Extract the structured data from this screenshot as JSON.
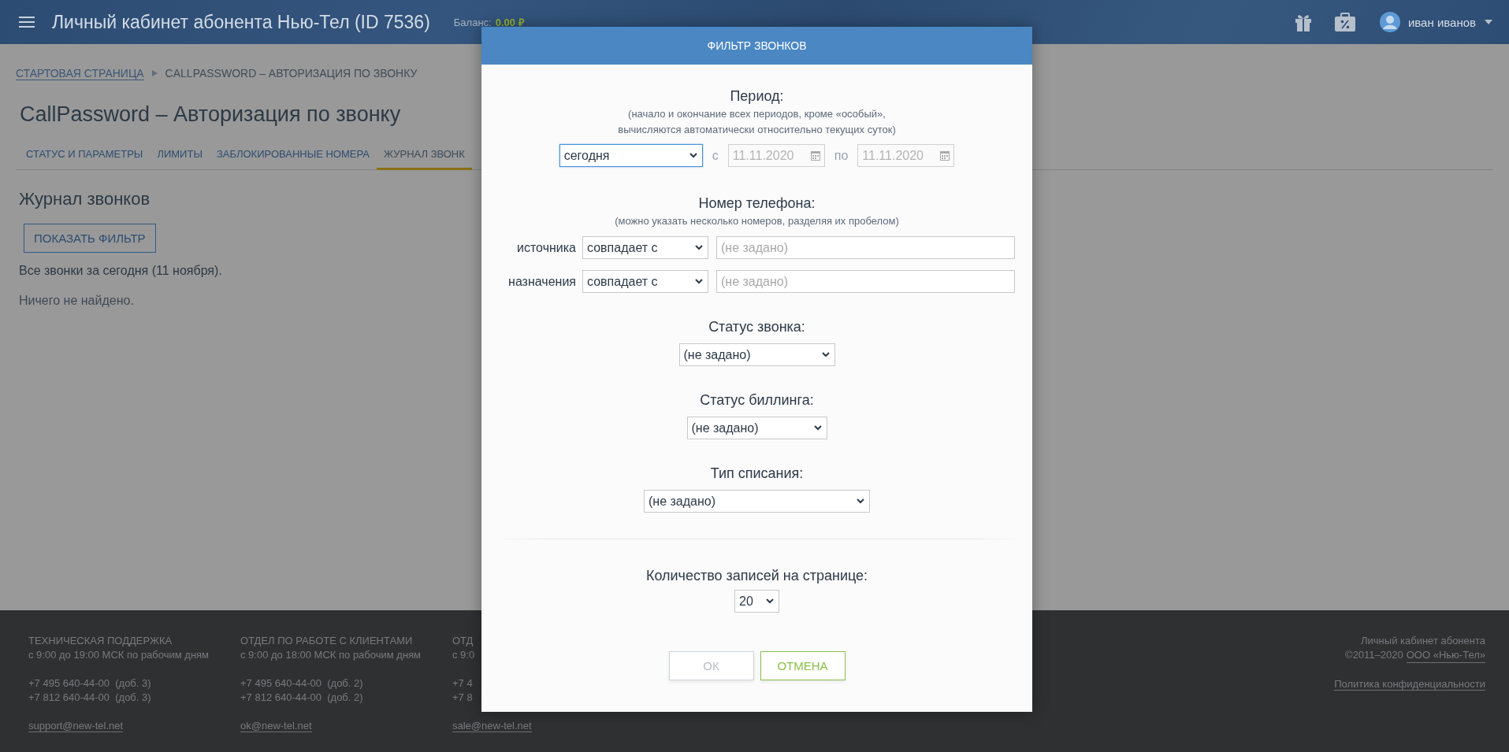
{
  "header": {
    "title": "Личный кабинет абонента Нью-Тел (ID 7536)",
    "balance_label": "Баланс:",
    "balance_value": "0.00 ₽",
    "user_name": "иван иванов"
  },
  "breadcrumbs": [
    {
      "label": "СТАРТОВАЯ СТРАНИЦА",
      "kind": "link"
    },
    {
      "label": "CALLPASSWORD – АВТОРИЗАЦИЯ ПО ЗВОНКУ",
      "kind": "current"
    }
  ],
  "page_title": "CallPassword – Авторизация по звонку",
  "tabs": [
    {
      "label": "СТАТУС И ПАРАМЕТРЫ",
      "selected": false
    },
    {
      "label": "ЛИМИТЫ",
      "selected": false
    },
    {
      "label": "ЗАБЛОКИРОВАННЫЕ НОМЕРА",
      "selected": false
    },
    {
      "label": "ЖУРНАЛ ЗВОНК",
      "selected": true
    }
  ],
  "call_log": {
    "heading": "Журнал звонков",
    "filter_button": "ПОКАЗАТЬ ФИЛЬТР",
    "summary": "Все звонки за сегодня (11 ноября).",
    "empty_message": "Ничего не найдено."
  },
  "dialog": {
    "title": "ФИЛЬТР ЗВОНКОВ",
    "period": {
      "label": "Период:",
      "hint_lines": [
        "(начало и окончание всех периодов, кроме «особый»,",
        "вычисляются автоматически относительно текущих суток)"
      ],
      "select": {
        "value": "сегодня",
        "focused": true
      },
      "from_label": "с",
      "from": {
        "value": "11.11.2020",
        "disabled": true
      },
      "to_label": "по",
      "to": {
        "value": "11.11.2020",
        "disabled": true
      }
    },
    "phone": {
      "label": "Номер телефона:",
      "hint": "(можно указать несколько номеров, разделяя их пробелом)",
      "rows": [
        {
          "label": "источника",
          "match": "совпадает с",
          "placeholder": "(не задано)"
        },
        {
          "label": "назначения",
          "match": "совпадает с",
          "placeholder": "(не задано)"
        }
      ]
    },
    "selects": [
      {
        "label": "Статус звонка:",
        "value": "(не задано)"
      },
      {
        "label": "Статус биллинга:",
        "value": "(не задано)"
      },
      {
        "label": "Тип списания:",
        "value": "(не задано)"
      }
    ],
    "page_size": {
      "label": "Количество записей на странице:",
      "value": "20"
    },
    "buttons": [
      {
        "label": "ОК",
        "kind": "primary",
        "disabled": true
      },
      {
        "label": "ОТМЕНА",
        "kind": "cancel",
        "disabled": false
      }
    ]
  },
  "footer": {
    "columns": [
      {
        "heading": "ТЕХНИЧЕСКАЯ ПОДДЕРЖКА",
        "hours": "с 9:00 до 19:00 МСК по рабочим дням",
        "phones": [
          "+7 495 640-44-00  (доб. 3)",
          "+7 812 640-44-00  (доб. 3)"
        ],
        "email": "support@new-tel.net"
      },
      {
        "heading": "ОТДЕЛ ПО РАБОТЕ С КЛИЕНТАМИ",
        "hours": "с 9:00 до 18:00 МСК по рабочим дням",
        "phones": [
          "+7 495 640-44-00  (доб. 2)",
          "+7 812 640-44-00  (доб. 2)"
        ],
        "email": "ok@new-tel.net"
      },
      {
        "heading": "ОТД",
        "hours": "с 9:0",
        "phones": [
          "+7 4",
          "+7 8"
        ],
        "email": "sale@new-tel.net"
      }
    ],
    "about": {
      "product": "Личный кабинет абонента",
      "copyright": "©2011–2020",
      "company_link": "ООО «Нью-Тел»",
      "privacy_link": "Политика конфиденциальности"
    }
  }
}
